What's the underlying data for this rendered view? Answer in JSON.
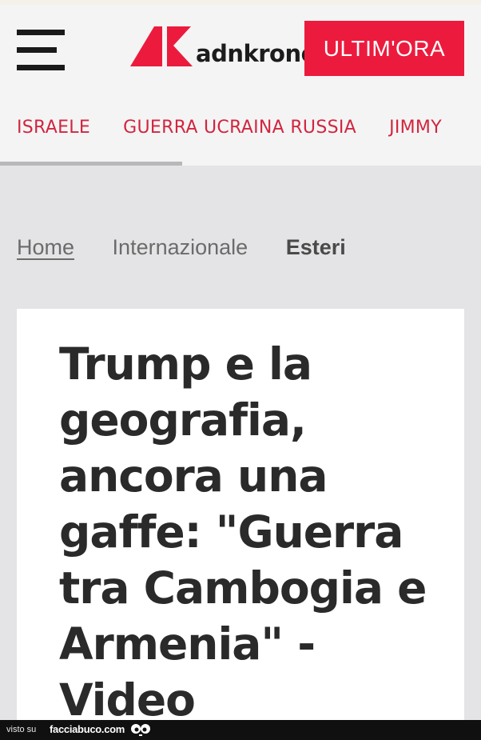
{
  "header": {
    "logo_text": "adnkronos",
    "ultim_ora_label": "ULTIM'ORA"
  },
  "nav": {
    "items": [
      {
        "label": "ISRAELE"
      },
      {
        "label": "GUERRA UCRAINA RUSSIA"
      },
      {
        "label": "JIMMY"
      }
    ]
  },
  "breadcrumb": {
    "home": "Home",
    "section": "Internazionale",
    "current": "Esteri"
  },
  "article": {
    "headline": "Trump e la geografia, ancora una gaffe: \"Guerra tra Cambogia e Armenia\" - Video"
  },
  "footer": {
    "visto_label": "visto su",
    "site": "facciabuco.com"
  },
  "colors": {
    "brand_red": "#ec1b3d",
    "nav_red": "#d1263e",
    "background": "#e4e4e6"
  },
  "icons": {
    "menu": "hamburger-icon",
    "footer_mascot": "eyes-icon"
  }
}
